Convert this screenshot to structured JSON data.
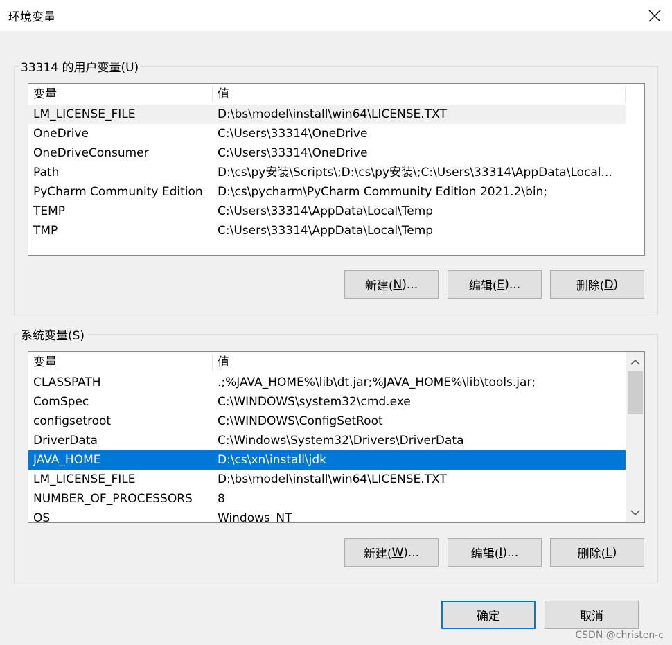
{
  "window": {
    "title": "环境变量"
  },
  "user_group": {
    "legend": "33314 的用户变量(U)",
    "columns": [
      "变量",
      "值"
    ],
    "rows": [
      {
        "name": "LM_LICENSE_FILE",
        "value": "D:\\bs\\model\\install\\win64\\LICENSE.TXT"
      },
      {
        "name": "OneDrive",
        "value": "C:\\Users\\33314\\OneDrive"
      },
      {
        "name": "OneDriveConsumer",
        "value": "C:\\Users\\33314\\OneDrive"
      },
      {
        "name": "Path",
        "value": "D:\\cs\\py安装\\Scripts\\;D:\\cs\\py安装\\;C:\\Users\\33314\\AppData\\Local..."
      },
      {
        "name": "PyCharm Community Edition",
        "value": "D:\\cs\\pycharm\\PyCharm Community Edition 2021.2\\bin;"
      },
      {
        "name": "TEMP",
        "value": "C:\\Users\\33314\\AppData\\Local\\Temp"
      },
      {
        "name": "TMP",
        "value": "C:\\Users\\33314\\AppData\\Local\\Temp"
      }
    ],
    "buttons": {
      "new": {
        "text": "新建(",
        "key": "N",
        "suffix": ")..."
      },
      "edit": {
        "text": "编辑(",
        "key": "E",
        "suffix": ")..."
      },
      "delete": {
        "text": "删除(",
        "key": "D",
        "suffix": ")"
      }
    }
  },
  "system_group": {
    "legend": "系统变量(S)",
    "columns": [
      "变量",
      "值"
    ],
    "rows": [
      {
        "name": "CLASSPATH",
        "value": ".;%JAVA_HOME%\\lib\\dt.jar;%JAVA_HOME%\\lib\\tools.jar;"
      },
      {
        "name": "ComSpec",
        "value": "C:\\WINDOWS\\system32\\cmd.exe"
      },
      {
        "name": "configsetroot",
        "value": "C:\\WINDOWS\\ConfigSetRoot"
      },
      {
        "name": "DriverData",
        "value": "C:\\Windows\\System32\\Drivers\\DriverData"
      },
      {
        "name": "JAVA_HOME",
        "value": "D:\\cs\\xn\\install\\jdk"
      },
      {
        "name": "LM_LICENSE_FILE",
        "value": "D:\\bs\\model\\install\\win64\\LICENSE.TXT"
      },
      {
        "name": "NUMBER_OF_PROCESSORS",
        "value": "8"
      },
      {
        "name": "OS",
        "value": "Windows_NT"
      }
    ],
    "buttons": {
      "new": {
        "text": "新建(",
        "key": "W",
        "suffix": ")..."
      },
      "edit": {
        "text": "编辑(",
        "key": "I",
        "suffix": ")..."
      },
      "delete": {
        "text": "删除(",
        "key": "L",
        "suffix": ")"
      }
    }
  },
  "footer": {
    "ok": "确定",
    "cancel": "取消"
  },
  "watermark": "CSDN @christen-c",
  "colors": {
    "selection": "#0078d7",
    "default_button_border": "#0078d7"
  },
  "icons": {
    "close": "close-icon",
    "scroll_up": "chevron-up-icon",
    "scroll_down": "chevron-down-icon"
  }
}
